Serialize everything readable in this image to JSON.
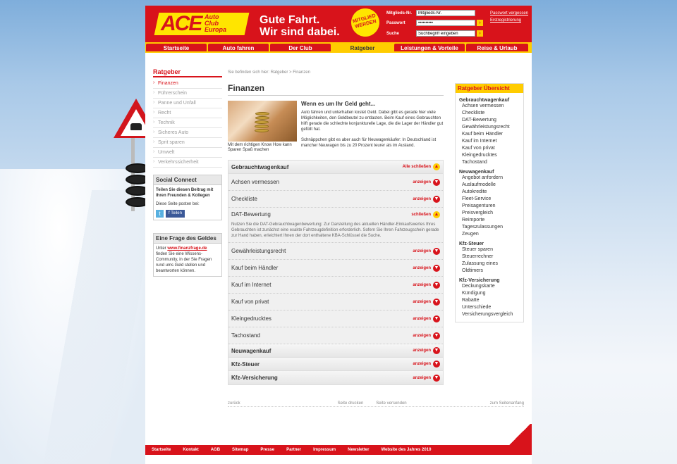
{
  "header": {
    "logo_main": "ACE",
    "logo_lines": [
      "Auto",
      "Club",
      "Europa"
    ],
    "slogan": [
      "Gute Fahrt.",
      "Wir sind dabei."
    ],
    "badge": "MITGLIED WERDEN",
    "member_label": "Mitglieds-Nr.",
    "member_value": "Mitglieds-Nr.",
    "password_label": "Passwort",
    "password_value": "••••••••••",
    "search_label": "Suche",
    "search_value": "Suchbegriff eingeben",
    "forgot": "Passwort vergessen",
    "register": "Erstregistrierung"
  },
  "nav": [
    "Startseite",
    "Auto fahren",
    "Der Club",
    "Ratgeber",
    "Leistungen & Vorteile",
    "Reise & Urlaub"
  ],
  "left": {
    "title": "Ratgeber",
    "items": [
      "Finanzen",
      "Führerschein",
      "Panne und Unfall",
      "Recht",
      "Technik",
      "Sicheres Auto",
      "Sprit sparen",
      "Umwelt",
      "Verkehrssicherheit"
    ],
    "social_title": "Social Connect",
    "social_bold": "Teilen Sie diesen Beitrag mit Ihren Freunden & Kollegen",
    "social_text": "Diese Seite posten bei:",
    "share_fb": "Teilen",
    "money_title": "Eine Frage des Geldes",
    "money_pre": "Unter ",
    "money_link": "www.finanzfrage.de",
    "money_post": " finden Sie eine Wissens-Community, in der Sie Fragen rund ums Geld stellen und beantworten können."
  },
  "main": {
    "breadcrumb": "Sie befinden sich hier: Ratgeber > Finanzen",
    "title": "Finanzen",
    "teaser_caption": "Mit dem richtigen Know How kann Sparen Spaß machen",
    "teaser_heading": "Wenn es um Ihr Geld geht...",
    "teaser_p1": "Auto fahren und unterhalten kostet Geld. Dabei gibt es gerade hier viele Möglichkeiten, den Geldbeutel zu entlasten. Beim Kauf eines Gebrauchten hilft gerade die schlechte konjunkturelle Lage, die die Lager der Händler gut gefüllt hat.",
    "teaser_p2": "Schnäppchen gibt es aber auch für Neuwagenkäufer: In Deutschland ist mancher Neuwagen bis zu 20 Prozent teurer als im Ausland.",
    "acc_head": "Gebrauchtwagenkauf",
    "acc_head_action": "Alle schließen",
    "acc_items": [
      "Achsen vermessen",
      "Checkliste"
    ],
    "acc_open": "DAT-Bewertung",
    "acc_open_action": "schließen",
    "acc_open_text": "Nutzen Sie die DAT-Gebrauchtwagenbewertung: Zur Darstellung des aktuellen Händler-Einkaufswertes Ihres Gebrauchten ist zunächst eine exakte Fahrzeugdefinition erforderlich. Sofern Sie Ihren Fahrzeugschein gerade zur Hand haben, erleichtert Ihnen der dort enthaltene KBA-Schlüssel die Suche.",
    "acc_items2": [
      "Gewährleistungsrecht",
      "Kauf beim Händler",
      "Kauf im Internet",
      "Kauf von privat",
      "Kleingedrucktes",
      "Tachostand"
    ],
    "acc_groups": [
      "Neuwagenkauf",
      "Kfz-Steuer",
      "Kfz-Versicherung"
    ],
    "show": "anzeigen",
    "footer_back": "zurück",
    "footer_print": "Seite drucken",
    "footer_send": "Seite versenden",
    "footer_top": "zum Seitenanfang"
  },
  "right": {
    "title": "Ratgeber Übersicht",
    "groups": [
      {
        "name": "Gebrauchtwagenkauf",
        "items": [
          "Achsen vermessen",
          "Checkliste",
          "DAT-Bewertung",
          "Gewährleistungsrecht",
          "Kauf beim Händler",
          "Kauf im Internet",
          "Kauf von privat",
          "Kleingedrucktes",
          "Tachostand"
        ]
      },
      {
        "name": "Neuwagenkauf",
        "items": [
          "Angebot anfordern",
          "Auslaufmodelle",
          "Autokredite",
          "Fleet-Service",
          "Preisagenturen",
          "Preisvergleich",
          "Reimporte",
          "Tageszulassungen",
          "Zeugen"
        ]
      },
      {
        "name": "Kfz-Steuer",
        "items": [
          "Steuer sparen",
          "Steuerrechner",
          "Zulassung eines Oldtimers"
        ]
      },
      {
        "name": "Kfz-Versicherung",
        "items": [
          "Deckungskarte",
          "Kündigung",
          "Rabatte",
          "Unterschiede",
          "Versicherungsvergleich"
        ]
      }
    ]
  },
  "footer": [
    "Startseite",
    "Kontakt",
    "AGB",
    "Sitemap",
    "Presse",
    "Partner",
    "Impressum",
    "Newsletter",
    "Website des Jahres 2010"
  ],
  "colors": {
    "brand_red": "#d8131b",
    "brand_yellow": "#ffcc00"
  }
}
